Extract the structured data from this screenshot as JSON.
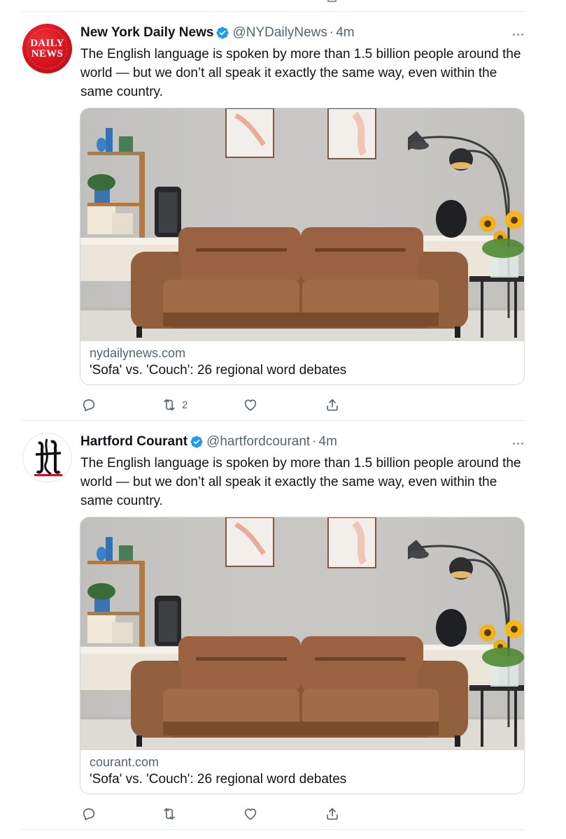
{
  "tweets": [
    {
      "author": {
        "name": "New York Daily News",
        "handle": "@NYDailyNews",
        "time": "4m",
        "avatar_text": [
          "DAILY",
          "NEWS"
        ]
      },
      "text": "The English language is spoken by more than 1.5 billion people around the world — but we don’t all speak it exactly the same way, even within the same country.",
      "card": {
        "domain": "nydailynews.com",
        "title": "'Sofa' vs. 'Couch': 26 regional word debates"
      },
      "actions": {
        "reply_count": "",
        "retweet_count": "2",
        "like_count": ""
      }
    },
    {
      "author": {
        "name": "Hartford Courant",
        "handle": "@hartfordcourant",
        "time": "4m"
      },
      "text": "The English language is spoken by more than 1.5 billion people around the world — but we don’t all speak it exactly the same way, even within the same country.",
      "card": {
        "domain": "courant.com",
        "title": "'Sofa' vs. 'Couch': 26 regional word debates"
      },
      "actions": {
        "reply_count": "",
        "retweet_count": "",
        "like_count": ""
      }
    }
  ],
  "icons": {
    "verified": "verified-badge-icon",
    "more": "more-options-icon",
    "reply": "reply-icon",
    "retweet": "retweet-icon",
    "like": "heart-icon",
    "share": "share-icon"
  },
  "colors": {
    "verified": "#1d9bf0",
    "secondary_text": "#536471",
    "divider": "#e6ecf0",
    "daily_news_red": "#d4111c"
  }
}
